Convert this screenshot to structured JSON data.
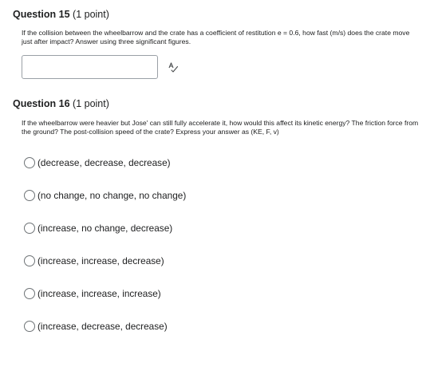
{
  "questions": [
    {
      "title": "Question 15",
      "points": "(1 point)",
      "text": "If the collision between the wheelbarrow and the crate has a coefficient of restitution e = 0.6, how fast (m/s) does the crate move just after impact? Answer using three significant figures.",
      "answer_value": "",
      "spellcheck_icon": "spellcheck-icon"
    },
    {
      "title": "Question 16",
      "points": "(1 point)",
      "text": "If the wheelbarrow were heavier but Jose' can still fully accelerate it, how would this affect its kinetic energy? The friction force from the ground? The post-collision speed of the crate? Express your answer as (KE, F, v)",
      "options": [
        "(decrease, decrease, decrease)",
        "(no change, no change, no change)",
        "(increase, no change, decrease)",
        "(increase, increase, decrease)",
        "(increase, increase, increase)",
        "(increase, decrease, decrease)"
      ]
    }
  ],
  "colors": {
    "text": "#202122",
    "input_border": "#9aa0a6",
    "radio_border": "#6e7376"
  }
}
